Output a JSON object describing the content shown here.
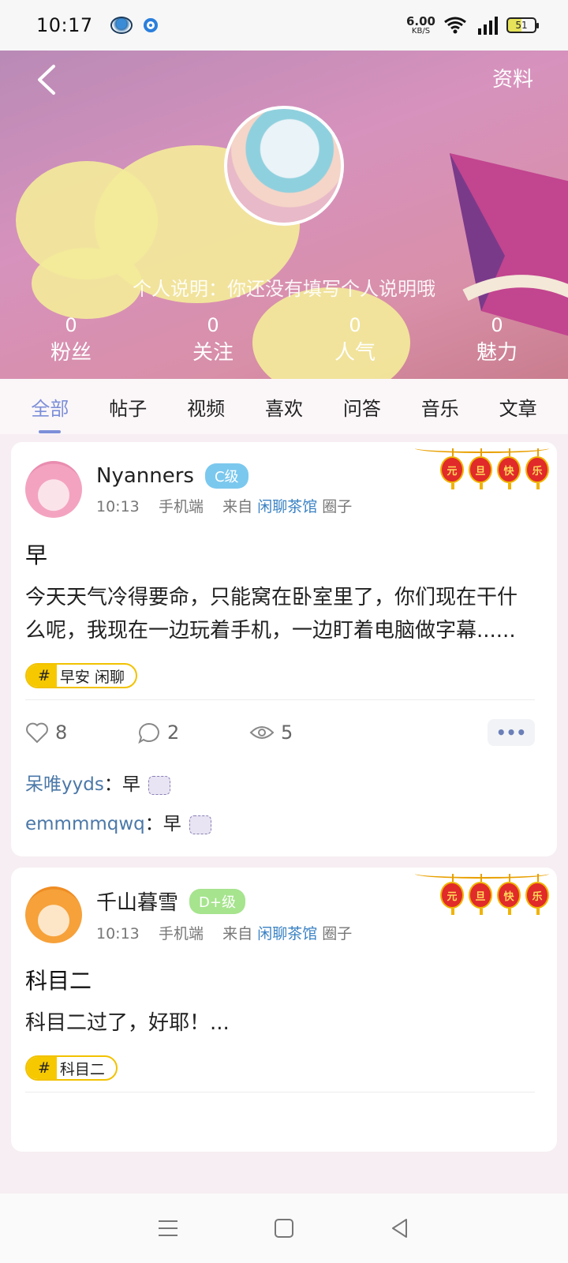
{
  "status_bar": {
    "time": "10:17",
    "net_speed": "6.00",
    "net_unit": "KB/S",
    "battery": "51"
  },
  "header": {
    "profile_link": "资料",
    "bio": "个人说明：你还没有填写个人说明哦",
    "stats": [
      {
        "value": "0",
        "label": "粉丝"
      },
      {
        "value": "0",
        "label": "关注"
      },
      {
        "value": "0",
        "label": "人气"
      },
      {
        "value": "0",
        "label": "魅力"
      }
    ]
  },
  "tabs": [
    "全部",
    "帖子",
    "视频",
    "喜欢",
    "问答",
    "音乐",
    "文章"
  ],
  "lanterns": [
    "元",
    "旦",
    "快",
    "乐"
  ],
  "posts": [
    {
      "username": "Nyanners",
      "level": "C级",
      "time": "10:13",
      "device": "手机端",
      "from": "来自",
      "circle": "闲聊茶馆",
      "circle_suffix": "圈子",
      "title": "早",
      "body": "今天天气冷得要命，只能窝在卧室里了，你们现在干什么呢，我现在一边玩着手机，一边盯着电脑做字幕......",
      "tag_hash": "#",
      "tag": "早安  闲聊",
      "likes": "8",
      "comments": "2",
      "views": "5",
      "replies": [
        {
          "who": "呆唯yyds",
          "sep": "：",
          "text": "早"
        },
        {
          "who": "emmmmqwq",
          "sep": "：",
          "text": "早"
        }
      ]
    },
    {
      "username": "千山暮雪",
      "level": "D+级",
      "time": "10:13",
      "device": "手机端",
      "from": "来自",
      "circle": "闲聊茶馆",
      "circle_suffix": "圈子",
      "title": "科目二",
      "body": "科目二过了，好耶！...",
      "tag_hash": "#",
      "tag": "科目二"
    }
  ],
  "more_label": "•••"
}
